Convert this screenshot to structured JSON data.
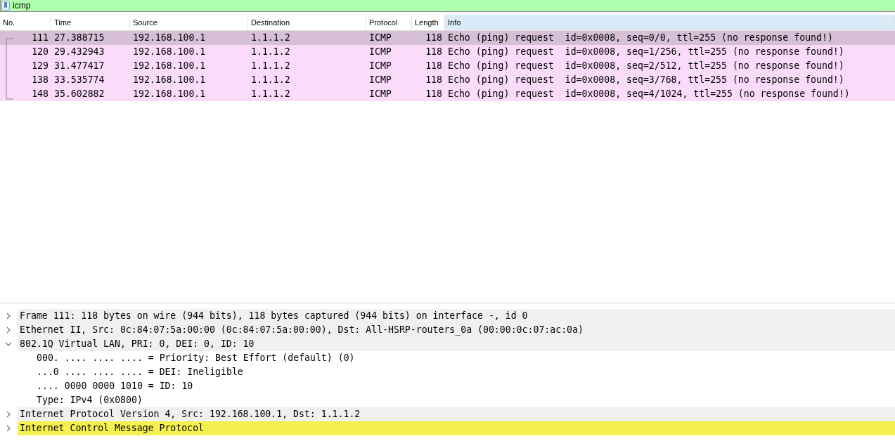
{
  "filter": {
    "value": "icmp"
  },
  "packet_list": {
    "columns": [
      {
        "label": "No.",
        "selected": false
      },
      {
        "label": "Time",
        "selected": false
      },
      {
        "label": "Source",
        "selected": false
      },
      {
        "label": "Destination",
        "selected": false
      },
      {
        "label": "Protocol",
        "selected": false
      },
      {
        "label": "Length",
        "selected": false
      },
      {
        "label": "Info",
        "selected": true
      }
    ],
    "rows": [
      {
        "selected": true,
        "cells": [
          "111",
          "27.388715",
          "192.168.100.1",
          "1.1.1.2",
          "ICMP",
          "118",
          "Echo (ping) request  id=0x0008, seq=0/0, ttl=255 (no response found!)"
        ]
      },
      {
        "selected": false,
        "cells": [
          "120",
          "29.432943",
          "192.168.100.1",
          "1.1.1.2",
          "ICMP",
          "118",
          "Echo (ping) request  id=0x0008, seq=1/256, ttl=255 (no response found!)"
        ]
      },
      {
        "selected": false,
        "cells": [
          "129",
          "31.477417",
          "192.168.100.1",
          "1.1.1.2",
          "ICMP",
          "118",
          "Echo (ping) request  id=0x0008, seq=2/512, ttl=255 (no response found!)"
        ]
      },
      {
        "selected": false,
        "cells": [
          "138",
          "33.535774",
          "192.168.100.1",
          "1.1.1.2",
          "ICMP",
          "118",
          "Echo (ping) request  id=0x0008, seq=3/768, ttl=255 (no response found!)"
        ]
      },
      {
        "selected": false,
        "cells": [
          "148",
          "35.602882",
          "192.168.100.1",
          "1.1.1.2",
          "ICMP",
          "118",
          "Echo (ping) request  id=0x0008, seq=4/1024, ttl=255 (no response found!)"
        ]
      }
    ]
  },
  "details": [
    {
      "label": "Frame 111: 118 bytes on wire (944 bits), 118 bytes captured (944 bits) on interface -, id 0",
      "expanded": false,
      "selected": false
    },
    {
      "label": "Ethernet II, Src: 0c:84:07:5a:00:00 (0c:84:07:5a:00:00), Dst: All-HSRP-routers_0a (00:00:0c:07:ac:0a)",
      "expanded": false,
      "selected": false
    },
    {
      "label": "802.1Q Virtual LAN, PRI: 0, DEI: 0, ID: 10",
      "expanded": true,
      "selected": false,
      "children": [
        {
          "label": "000. .... .... .... = Priority: Best Effort (default) (0)"
        },
        {
          "label": "...0 .... .... .... = DEI: Ineligible"
        },
        {
          "label": ".... 0000 0000 1010 = ID: 10"
        },
        {
          "label": "Type: IPv4 (0x0800)"
        }
      ]
    },
    {
      "label": "Internet Protocol Version 4, Src: 192.168.100.1, Dst: 1.1.1.2",
      "expanded": false,
      "selected": false
    },
    {
      "label": "Internet Control Message Protocol",
      "expanded": false,
      "selected": true
    }
  ]
}
